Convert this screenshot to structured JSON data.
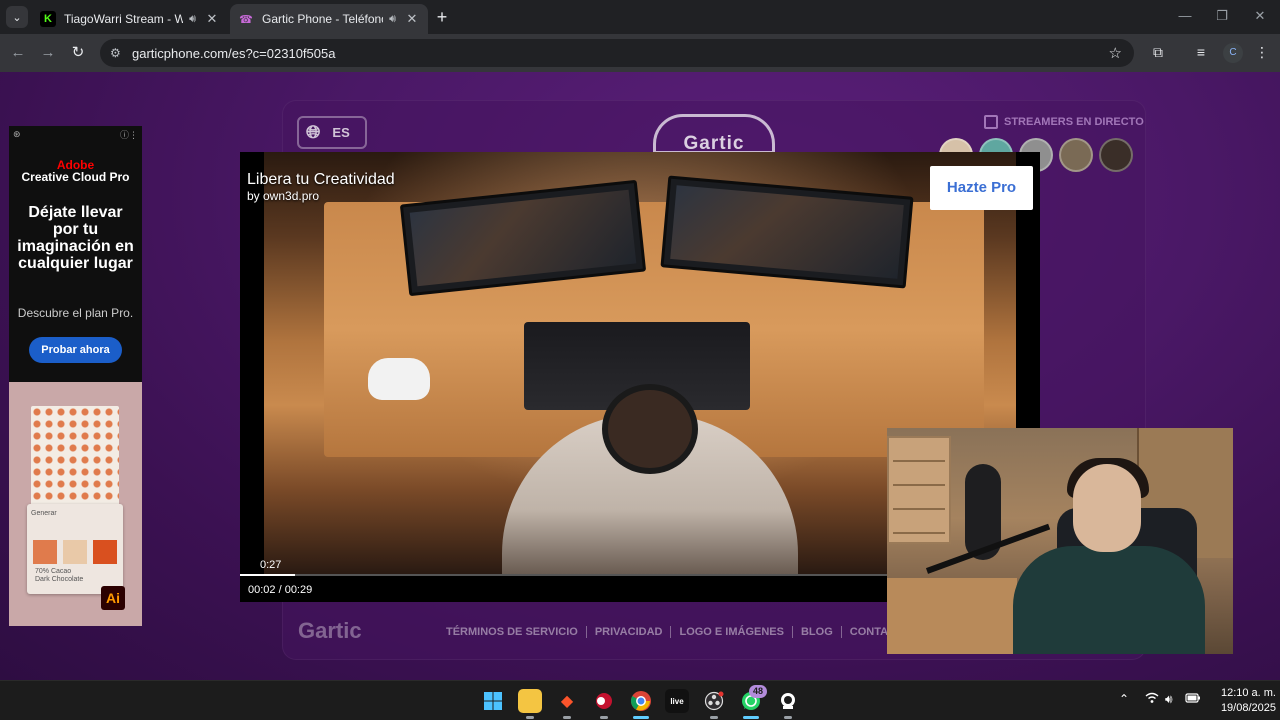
{
  "browser": {
    "tabs": [
      {
        "title": "TiagoWarri Stream - Watch",
        "favicon": "kick-icon",
        "favicon_color": "#53fc18",
        "audio": true,
        "active": false
      },
      {
        "title": "Gartic Phone - Teléfono De",
        "favicon": "phone-icon",
        "favicon_color": "#c86ad8",
        "audio": true,
        "active": true
      }
    ],
    "url": "garticphone.com/es?c=02310f505a",
    "profile_initial": "C"
  },
  "page": {
    "language_label": "ES",
    "logo_text": "Gartic",
    "streamers_label": "STREAMERS EN DIRECTO",
    "footer_logo": "Gartic",
    "footer_links": [
      "TÉRMINOS DE SERVICIO",
      "PRIVACIDAD",
      "LOGO E IMÁGENES",
      "BLOG",
      "CONTACTO"
    ]
  },
  "left_ad": {
    "brand_line1": "Adobe",
    "brand_line2": "Creative Cloud Pro",
    "headline": "Déjate llevar por tu imaginación en cualquier lugar",
    "subline": "Descubre el plan Pro.",
    "cta": "Probar ahora",
    "product_tag": "Generar",
    "product_caption1": "70% Cacao",
    "product_caption2": "Dark Chocolate",
    "app_badge": "Ai"
  },
  "video_ad": {
    "title": "Libera tu Creatividad",
    "byline": "by own3d.pro",
    "cta": "Hazte Pro",
    "countdown": "0:27",
    "time_display": "00:02 / 00:29",
    "progress": 0.069
  },
  "taskbar": {
    "whatsapp_badge": "48",
    "clock_time": "12:10 a. m.",
    "clock_date": "19/08/2025"
  },
  "colors": {
    "page_bg": "#4a1866",
    "ad_cta": "#1b5ec9",
    "hazte_pro_text": "#3b6fd4",
    "taskbar_active": "#60cdff"
  }
}
